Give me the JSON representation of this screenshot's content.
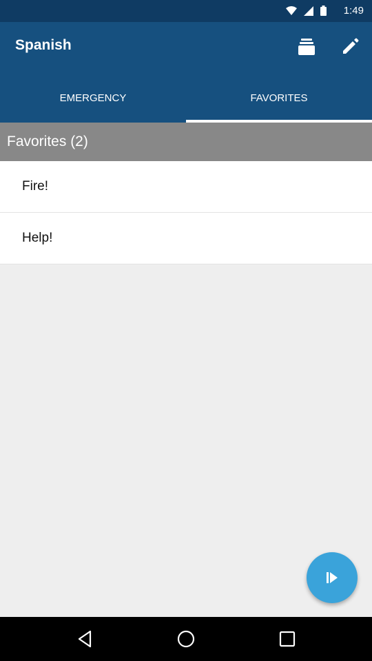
{
  "status_bar": {
    "time": "1:49"
  },
  "app_bar": {
    "title": "Spanish",
    "actions": [
      {
        "icon": "stack-icon"
      },
      {
        "icon": "pencil-icon"
      }
    ]
  },
  "tabs": [
    {
      "label": "EMERGENCY",
      "active": false
    },
    {
      "label": "FAVORITES",
      "active": true
    }
  ],
  "section": {
    "header": "Favorites (2)"
  },
  "list": {
    "items": [
      {
        "label": "Fire!"
      },
      {
        "label": "Help!"
      }
    ]
  },
  "fab": {
    "icon": "play-next-icon"
  },
  "nav_bar": {
    "buttons": [
      {
        "icon": "back-icon"
      },
      {
        "icon": "home-icon"
      },
      {
        "icon": "recents-icon"
      }
    ]
  },
  "colors": {
    "status_bar": "#0f3b63",
    "app_bar": "#16507f",
    "section_header": "#888888",
    "fab": "#3aa3da"
  }
}
